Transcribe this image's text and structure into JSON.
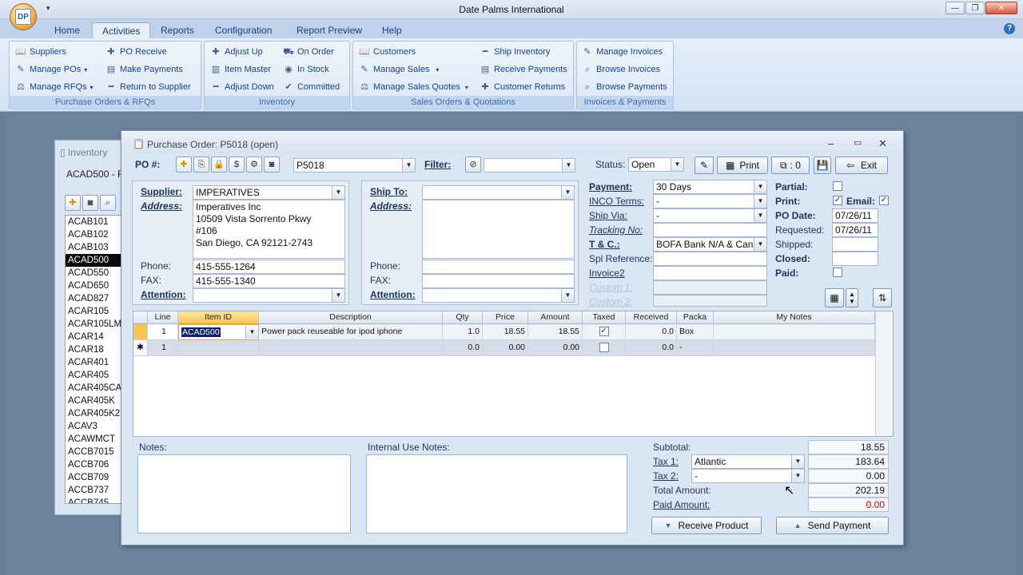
{
  "app": {
    "title": "Date Palms International",
    "logo_text": "DP"
  },
  "tabs": [
    "Home",
    "Activities",
    "Reports",
    "Configuration",
    "Report Preview",
    "Help"
  ],
  "active_tab": "Activities",
  "ribbon": {
    "purchase": {
      "caption": "Purchase Orders & RFQs",
      "items": [
        "Suppliers",
        "PO Receive",
        "Manage POs",
        "Make Payments",
        "Manage RFQs",
        "Return to Supplier"
      ]
    },
    "inventory": {
      "caption": "Inventory",
      "items": [
        "Adjust Up",
        "On Order",
        "Item Master",
        "In Stock",
        "Adjust Down",
        "Committed"
      ]
    },
    "sales": {
      "caption": "Sales Orders & Quotations",
      "items": [
        "Customers",
        "Ship Inventory",
        "Manage Sales",
        "Receive Payments",
        "Manage Sales Quotes",
        "Customer Returns"
      ]
    },
    "invoices": {
      "caption": "Invoices & Payments",
      "items": [
        "Manage Invoices",
        "Browse Invoices",
        "Browse Payments"
      ]
    }
  },
  "inventory_window": {
    "title": "Inventory",
    "subtitle": "ACAD500 - F",
    "items": [
      "ACAB101",
      "ACAB102",
      "ACAB103",
      "ACAD500",
      "ACAD550",
      "ACAD650",
      "ACAD827",
      "ACAR105",
      "ACAR105LM",
      "ACAR14",
      "ACAR18",
      "ACAR401",
      "ACAR405",
      "ACAR405CA",
      "ACAR405K",
      "ACAR405K2",
      "ACAV3",
      "ACAWMCT",
      "ACCB7015",
      "ACCB706",
      "ACCB709",
      "ACCB737",
      "ACCB745"
    ],
    "selected": "ACAD500"
  },
  "po": {
    "title": "Purchase Order: P5018 (open)",
    "po_label": "PO #:",
    "po_number": "P5018",
    "filter_label": "Filter:",
    "filter_value": "",
    "status_label": "Status:",
    "status_value": "Open",
    "print_label": "Print",
    "copies_label": ": 0",
    "exit_label": "Exit",
    "supplier": {
      "label": "Supplier:",
      "value": "IMPERATIVES",
      "address_label": "Address:",
      "address": [
        "Imperatives Inc",
        "10509 Vista Sorrento Pkwy",
        "#106",
        "San Diego, CA 92121-2743"
      ],
      "phone_label": "Phone:",
      "phone": "415-555-1264",
      "fax_label": "FAX:",
      "fax": "415-555-1340",
      "attention_label": "Attention:",
      "attention": ""
    },
    "shipto": {
      "label": "Ship To:",
      "value": "",
      "address_label": "Address:",
      "phone_label": "Phone:",
      "phone": "",
      "fax_label": "FAX:",
      "fax": "",
      "attention_label": "Attention:",
      "attention": ""
    },
    "terms": {
      "payment_label": "Payment:",
      "payment": "30 Days",
      "inco_label": "INCO Terms:",
      "inco": "-",
      "shipvia_label": "Ship Via:",
      "shipvia": "-",
      "tracking_label": "Tracking No:",
      "tracking": "",
      "tc_label": "T & C.:",
      "tc": "BOFA Bank N/A & Cana",
      "splref_label": "Spl Reference:",
      "splref": "",
      "invoice2_label": "Invoice2",
      "invoice2": "",
      "custom1_label": "Custom 1:",
      "custom2_label": "Custom 2:"
    },
    "flags": {
      "partial_label": "Partial:",
      "print_label": "Print:",
      "email_label": "Email:",
      "podate_label": "PO Date:",
      "podate": "07/26/11",
      "requested_label": "Requested:",
      "requested": "07/26/11",
      "shipped_label": "Shipped:",
      "shipped": "",
      "closed_label": "Closed:",
      "closed": "",
      "paid_label": "Paid:"
    },
    "grid": {
      "headers": [
        "Line",
        "Item ID",
        "Description",
        "Qty",
        "Price",
        "Amount",
        "Taxed",
        "Received",
        "Packa",
        "My Notes"
      ],
      "rows": [
        {
          "line": "1",
          "item": "ACAD500",
          "desc": "Power pack reuseable for ipod iphone",
          "qty": "1.0",
          "price": "18.55",
          "amount": "18.55",
          "received": "0.0",
          "pack": "Box"
        },
        {
          "line": "1",
          "item": "",
          "desc": "",
          "qty": "0.0",
          "price": "0.00",
          "amount": "0.00",
          "received": "0.0",
          "pack": "-"
        }
      ]
    },
    "notes_label": "Notes:",
    "internal_notes_label": "Internal Use Notes:",
    "totals": {
      "subtotal_label": "Subtotal:",
      "subtotal": "18.55",
      "tax1_label": "Tax 1:",
      "tax1_name": "Atlantic",
      "tax1": "183.64",
      "tax2_label": "Tax 2:",
      "tax2_name": "-",
      "tax2": "0.00",
      "total_label": "Total Amount:",
      "total": "202.19",
      "paid_label": "Paid Amount:",
      "paid": "0.00"
    },
    "receive_label": "Receive Product",
    "send_label": "Send Payment"
  },
  "colors": {
    "accent": "#15428b",
    "paid_red": "#cc0000",
    "selection": "#0a0a0a"
  }
}
